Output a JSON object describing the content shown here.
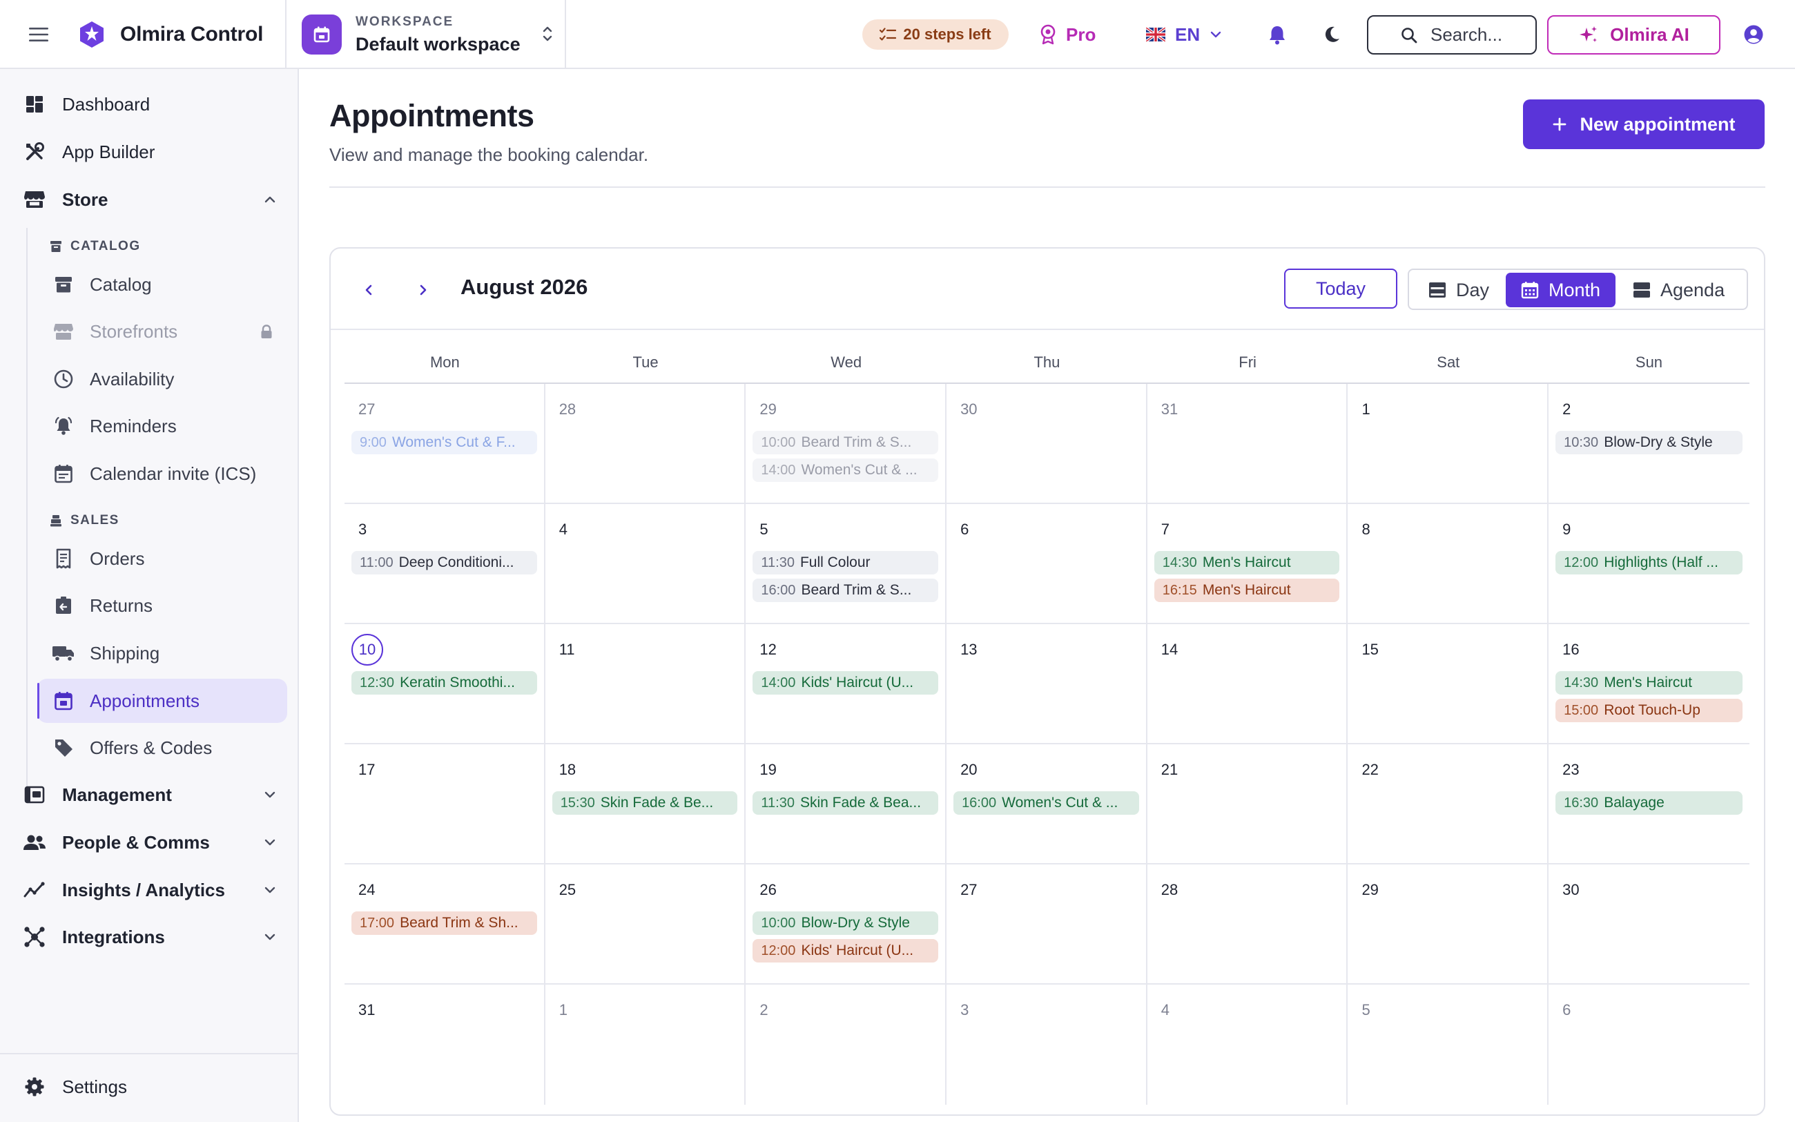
{
  "app": {
    "name": "Olmira Control"
  },
  "workspace": {
    "label": "WORKSPACE",
    "name": "Default workspace"
  },
  "topbar": {
    "steps_left": "20 steps left",
    "plan": "Pro",
    "language": "EN",
    "search_placeholder": "Search...",
    "ai_label": "Olmira AI"
  },
  "sidebar": {
    "top": [
      {
        "id": "dashboard",
        "label": "Dashboard",
        "icon": "dashboard-icon"
      },
      {
        "id": "app-builder",
        "label": "App Builder",
        "icon": "tools-icon"
      }
    ],
    "store_label": "Store",
    "catalog_heading": "CATALOG",
    "catalog_items": [
      {
        "label": "Catalog",
        "icon": "archive-icon",
        "disabled": false
      },
      {
        "label": "Storefronts",
        "icon": "storefront-icon",
        "disabled": true,
        "locked": true
      },
      {
        "label": "Availability",
        "icon": "clock-icon",
        "disabled": false
      },
      {
        "label": "Reminders",
        "icon": "bell-ring-icon",
        "disabled": false
      },
      {
        "label": "Calendar invite (ICS)",
        "icon": "calendar-text-icon",
        "disabled": false
      }
    ],
    "sales_heading": "SALES",
    "sales_items": [
      {
        "label": "Orders",
        "icon": "receipt-icon",
        "active": false
      },
      {
        "label": "Returns",
        "icon": "return-box-icon",
        "active": false
      },
      {
        "label": "Shipping",
        "icon": "truck-icon",
        "active": false
      },
      {
        "label": "Appointments",
        "icon": "calendar-icon",
        "active": true
      },
      {
        "label": "Offers & Codes",
        "icon": "tag-icon",
        "active": false
      }
    ],
    "sections": [
      {
        "label": "Management",
        "icon": "management-icon"
      },
      {
        "label": "People & Comms",
        "icon": "people-icon"
      },
      {
        "label": "Insights / Analytics",
        "icon": "analytics-icon"
      },
      {
        "label": "Integrations",
        "icon": "integrations-icon"
      }
    ],
    "settings_label": "Settings"
  },
  "page": {
    "title": "Appointments",
    "subtitle": "View and manage the booking calendar.",
    "new_button": "New appointment"
  },
  "calendar": {
    "month_label": "August 2026",
    "today_label": "Today",
    "views": [
      {
        "label": "Day",
        "active": false
      },
      {
        "label": "Month",
        "active": true
      },
      {
        "label": "Agenda",
        "active": false
      }
    ],
    "weekdays": [
      "Mon",
      "Tue",
      "Wed",
      "Thu",
      "Fri",
      "Sat",
      "Sun"
    ],
    "weeks": [
      [
        {
          "day": "27",
          "other": true,
          "events": [
            {
              "time": "9:00",
              "title": "Women's Cut & F...",
              "style": "blue-faded"
            }
          ]
        },
        {
          "day": "28",
          "other": true,
          "events": []
        },
        {
          "day": "29",
          "other": true,
          "events": [
            {
              "time": "10:00",
              "title": "Beard Trim & S...",
              "style": "neutral-faded"
            },
            {
              "time": "14:00",
              "title": "Women's Cut & ...",
              "style": "neutral-faded"
            }
          ]
        },
        {
          "day": "30",
          "other": true,
          "events": []
        },
        {
          "day": "31",
          "other": true,
          "events": []
        },
        {
          "day": "1",
          "events": []
        },
        {
          "day": "2",
          "events": [
            {
              "time": "10:30",
              "title": "Blow-Dry & Style",
              "style": "neutral"
            }
          ]
        }
      ],
      [
        {
          "day": "3",
          "events": [
            {
              "time": "11:00",
              "title": "Deep Conditioni...",
              "style": "neutral"
            }
          ]
        },
        {
          "day": "4",
          "events": []
        },
        {
          "day": "5",
          "events": [
            {
              "time": "11:30",
              "title": "Full Colour",
              "style": "neutral"
            },
            {
              "time": "16:00",
              "title": "Beard Trim & S...",
              "style": "neutral"
            }
          ]
        },
        {
          "day": "6",
          "events": []
        },
        {
          "day": "7",
          "events": [
            {
              "time": "14:30",
              "title": "Men's Haircut",
              "style": "green"
            },
            {
              "time": "16:15",
              "title": "Men's Haircut",
              "style": "orange"
            }
          ]
        },
        {
          "day": "8",
          "events": []
        },
        {
          "day": "9",
          "events": [
            {
              "time": "12:00",
              "title": "Highlights (Half ...",
              "style": "green"
            }
          ]
        }
      ],
      [
        {
          "day": "10",
          "today": true,
          "events": [
            {
              "time": "12:30",
              "title": "Keratin Smoothi...",
              "style": "green"
            }
          ]
        },
        {
          "day": "11",
          "events": []
        },
        {
          "day": "12",
          "events": [
            {
              "time": "14:00",
              "title": "Kids' Haircut (U...",
              "style": "green"
            }
          ]
        },
        {
          "day": "13",
          "events": []
        },
        {
          "day": "14",
          "events": []
        },
        {
          "day": "15",
          "events": []
        },
        {
          "day": "16",
          "events": [
            {
              "time": "14:30",
              "title": "Men's Haircut",
              "style": "green"
            },
            {
              "time": "15:00",
              "title": "Root Touch-Up",
              "style": "orange"
            }
          ]
        }
      ],
      [
        {
          "day": "17",
          "events": []
        },
        {
          "day": "18",
          "events": [
            {
              "time": "15:30",
              "title": "Skin Fade & Be...",
              "style": "green"
            }
          ]
        },
        {
          "day": "19",
          "events": [
            {
              "time": "11:30",
              "title": "Skin Fade & Bea...",
              "style": "green"
            }
          ]
        },
        {
          "day": "20",
          "events": [
            {
              "time": "16:00",
              "title": "Women's Cut & ...",
              "style": "green"
            }
          ]
        },
        {
          "day": "21",
          "events": []
        },
        {
          "day": "22",
          "events": []
        },
        {
          "day": "23",
          "events": [
            {
              "time": "16:30",
              "title": "Balayage",
              "style": "green"
            }
          ]
        }
      ],
      [
        {
          "day": "24",
          "events": [
            {
              "time": "17:00",
              "title": "Beard Trim & Sh...",
              "style": "orange"
            }
          ]
        },
        {
          "day": "25",
          "events": []
        },
        {
          "day": "26",
          "events": [
            {
              "time": "10:00",
              "title": "Blow-Dry & Style",
              "style": "green"
            },
            {
              "time": "12:00",
              "title": "Kids' Haircut (U...",
              "style": "orange"
            }
          ]
        },
        {
          "day": "27",
          "events": []
        },
        {
          "day": "28",
          "events": []
        },
        {
          "day": "29",
          "events": []
        },
        {
          "day": "30",
          "events": []
        }
      ],
      [
        {
          "day": "31",
          "events": []
        },
        {
          "day": "1",
          "other": true,
          "events": []
        },
        {
          "day": "2",
          "other": true,
          "events": []
        },
        {
          "day": "3",
          "other": true,
          "events": []
        },
        {
          "day": "4",
          "other": true,
          "events": []
        },
        {
          "day": "5",
          "other": true,
          "events": []
        },
        {
          "day": "6",
          "other": true,
          "events": []
        }
      ]
    ]
  }
}
